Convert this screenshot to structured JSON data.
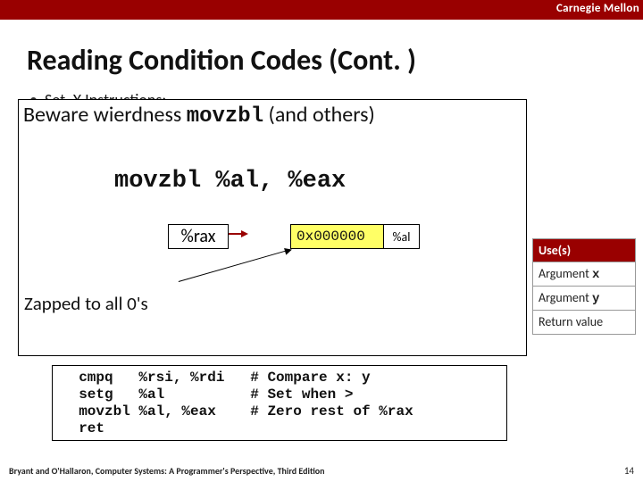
{
  "univ": "Carnegie Mellon",
  "title": "Reading Condition Codes (Cont. )",
  "bullet1": "Set. X Instructions:",
  "beware_pre": "Beware wierdness ",
  "beware_code": "movzbl",
  "beware_post": " (and others)",
  "code_line": "movzbl %al, %eax",
  "rax_label": "%rax",
  "val_left": "0x000000",
  "val_right": "%al",
  "zapped": "Zapped to all 0's",
  "reg_header2": "Use(s)",
  "reg_rows": [
    {
      "use_pre": "Argument ",
      "use_code": "x"
    },
    {
      "use_pre": "Argument ",
      "use_code": "y"
    },
    {
      "use_pre": "Return value",
      "use_code": ""
    }
  ],
  "asm": "  cmpq   %rsi, %rdi   # Compare x: y\n  setg   %al          # Set when >\n  movzbl %al, %eax    # Zero rest of %rax\n  ret",
  "footer": "Bryant and O'Hallaron, Computer Systems: A Programmer's Perspective, Third Edition",
  "pageno": "14"
}
